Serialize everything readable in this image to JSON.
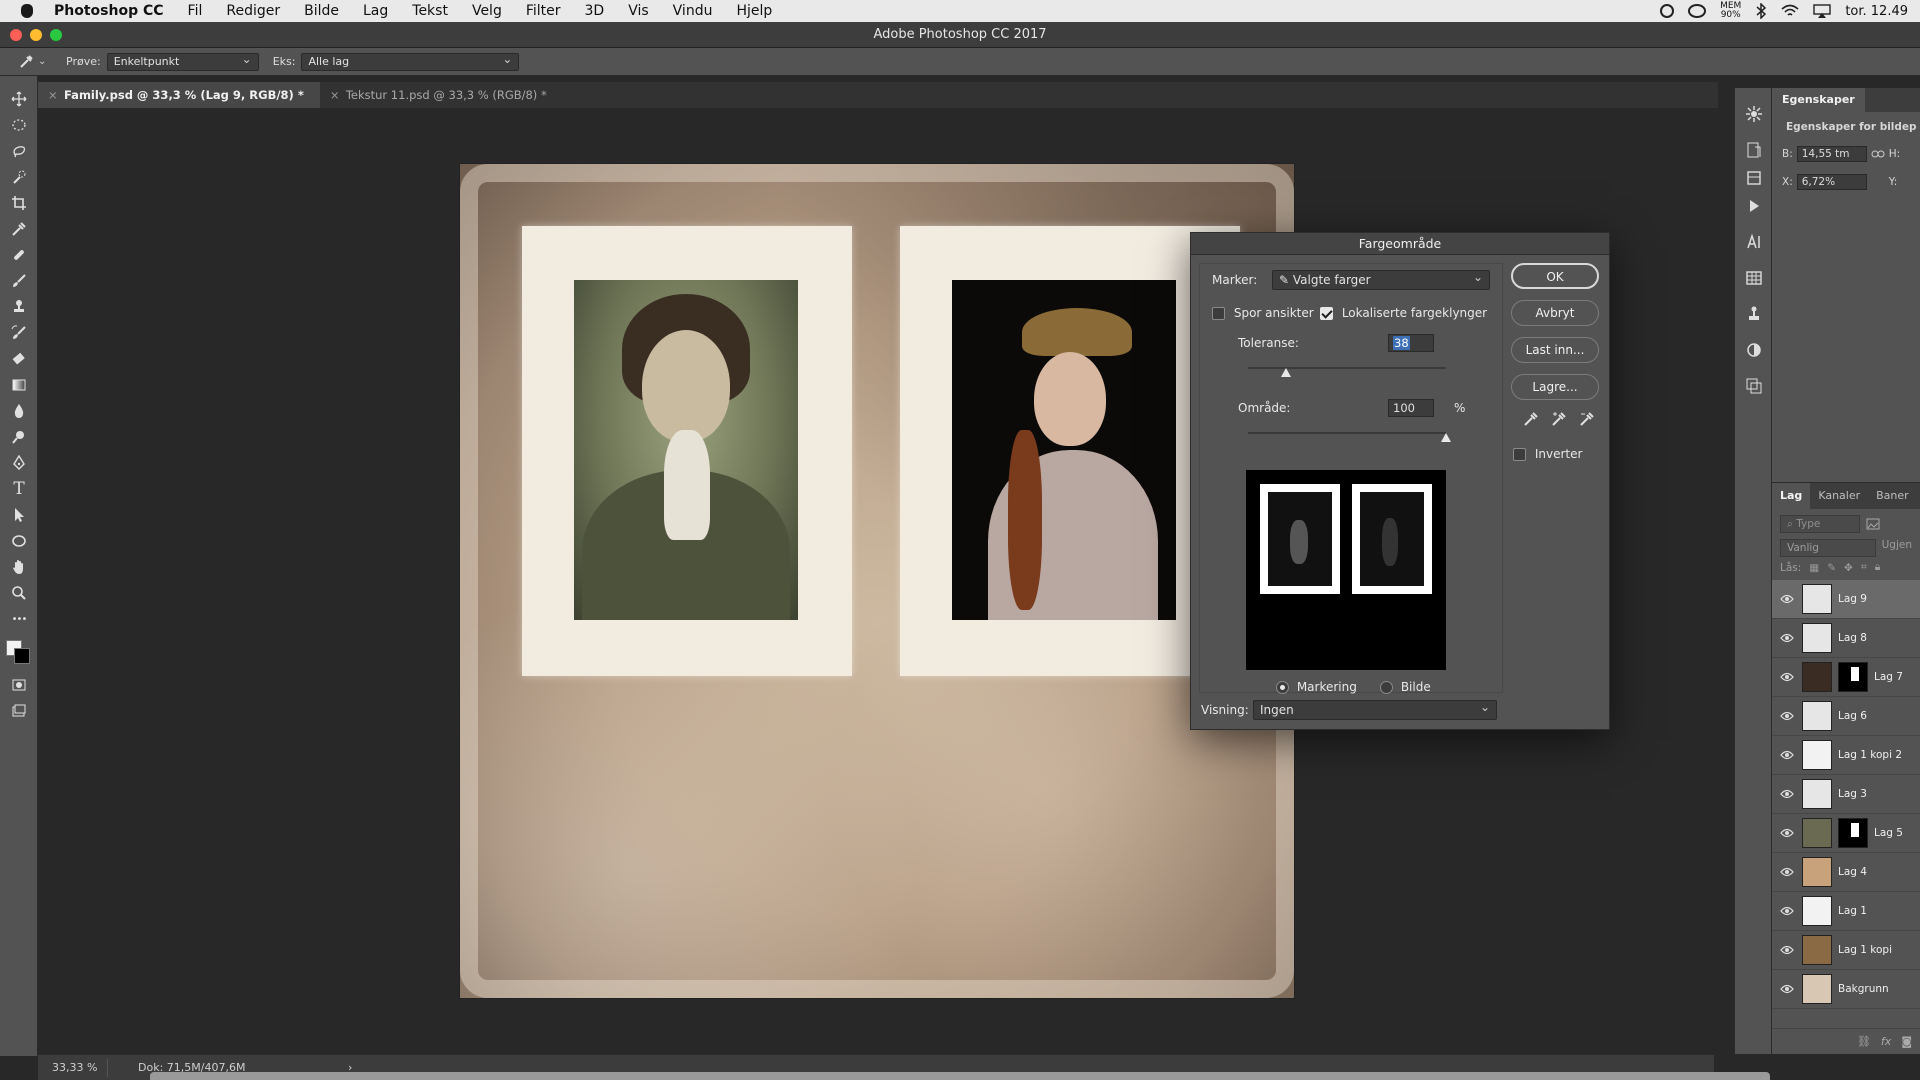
{
  "menubar": {
    "app_name": "Photoshop CC",
    "items": [
      "Fil",
      "Rediger",
      "Bilde",
      "Lag",
      "Tekst",
      "Velg",
      "Filter",
      "3D",
      "Vis",
      "Vindu",
      "Hjelp"
    ],
    "mem_label": "MEM",
    "mem_value": "90%",
    "clock": "tor. 12.49"
  },
  "window": {
    "title": "Adobe Photoshop CC 2017",
    "light_colors": [
      "#ff5f57",
      "#febc2e",
      "#28c840"
    ]
  },
  "options": {
    "sample_label": "Prøve:",
    "sample_value": "Enkeltpunkt",
    "sample_layers_label": "Eks:",
    "sample_layers_value": "Alle lag"
  },
  "tabs": [
    {
      "label": "Family.psd @ 33,3 % (Lag 9, RGB/8) *",
      "active": true
    },
    {
      "label": "Tekstur 11.psd @ 33,3 % (RGB/8) *",
      "active": false
    }
  ],
  "toolbar": {
    "icons": [
      "move-icon",
      "marquee-icon",
      "lasso-icon",
      "quick-select-icon",
      "crop-icon",
      "eyedropper-icon",
      "healing-icon",
      "brush-icon",
      "stamp-icon",
      "history-brush-icon",
      "eraser-icon",
      "gradient-icon",
      "blur-icon",
      "dodge-icon",
      "pen-icon",
      "type-icon",
      "path-select-icon",
      "ellipse-icon",
      "hand-icon",
      "zoom-icon",
      "more-icon"
    ],
    "type_glyph": "T",
    "more_glyph": "•••"
  },
  "status": {
    "zoom": "33,33 %",
    "doc": "Dok: 71,5M/407,6M",
    "arrow": "›"
  },
  "properties": {
    "tab": "Egenskaper",
    "heading": "Egenskaper for bildep",
    "w_label": "B:",
    "w_value": "14,55 tm",
    "h_label": "H:",
    "x_label": "X:",
    "x_value": "6,72%",
    "y_label": "Y:"
  },
  "layers_panel": {
    "tabs": [
      "Lag",
      "Kanaler",
      "Baner"
    ],
    "filter_placeholder": "Type",
    "blend_mode": "Vanlig",
    "opacity_label": "Ugjen",
    "lock_label": "Lås:",
    "layers": [
      {
        "name": "Lag 9",
        "selected": true,
        "thumb": "#e6e6e6",
        "mask": false
      },
      {
        "name": "Lag 8",
        "selected": false,
        "thumb": "#e6e6e6",
        "mask": false
      },
      {
        "name": "Lag 7",
        "selected": false,
        "thumb": "#3a2c22",
        "mask": true
      },
      {
        "name": "Lag 6",
        "selected": false,
        "thumb": "#e6e6e6",
        "mask": false
      },
      {
        "name": "Lag 1 kopi 2",
        "selected": false,
        "thumb": "#f2f2f2",
        "mask": false
      },
      {
        "name": "Lag 3",
        "selected": false,
        "thumb": "#e6e6e6",
        "mask": false
      },
      {
        "name": "Lag 5",
        "selected": false,
        "thumb": "#6a6a52",
        "mask": true
      },
      {
        "name": "Lag 4",
        "selected": false,
        "thumb": "#c8a27a",
        "mask": false
      },
      {
        "name": "Lag 1",
        "selected": false,
        "thumb": "#f2f2f2",
        "mask": false
      },
      {
        "name": "Lag 1 kopi",
        "selected": false,
        "thumb": "#8a6a44",
        "mask": false
      },
      {
        "name": "Bakgrunn",
        "selected": false,
        "thumb": "#d8c7b3",
        "mask": false
      }
    ]
  },
  "dialog": {
    "title": "Fargeområde",
    "select_label": "Marker:",
    "select_value": "Valgte farger",
    "detect_faces_label": "Spor ansikter",
    "detect_faces_checked": false,
    "localized_label": "Lokaliserte fargeklynger",
    "localized_checked": true,
    "fuzziness_label": "Toleranse:",
    "fuzziness_value": "38",
    "fuzziness_max": 200,
    "range_label": "Område:",
    "range_value": "100",
    "range_percent": 100,
    "percent_sign": "%",
    "view_selection_label": "Markering",
    "view_image_label": "Bilde",
    "view_mode": "Markering",
    "preview_label": "Visning:",
    "preview_value": "Ingen",
    "buttons": {
      "ok": "OK",
      "cancel": "Avbryt",
      "load": "Last inn...",
      "save": "Lagre..."
    },
    "invert_label": "Inverter",
    "invert_checked": false
  }
}
